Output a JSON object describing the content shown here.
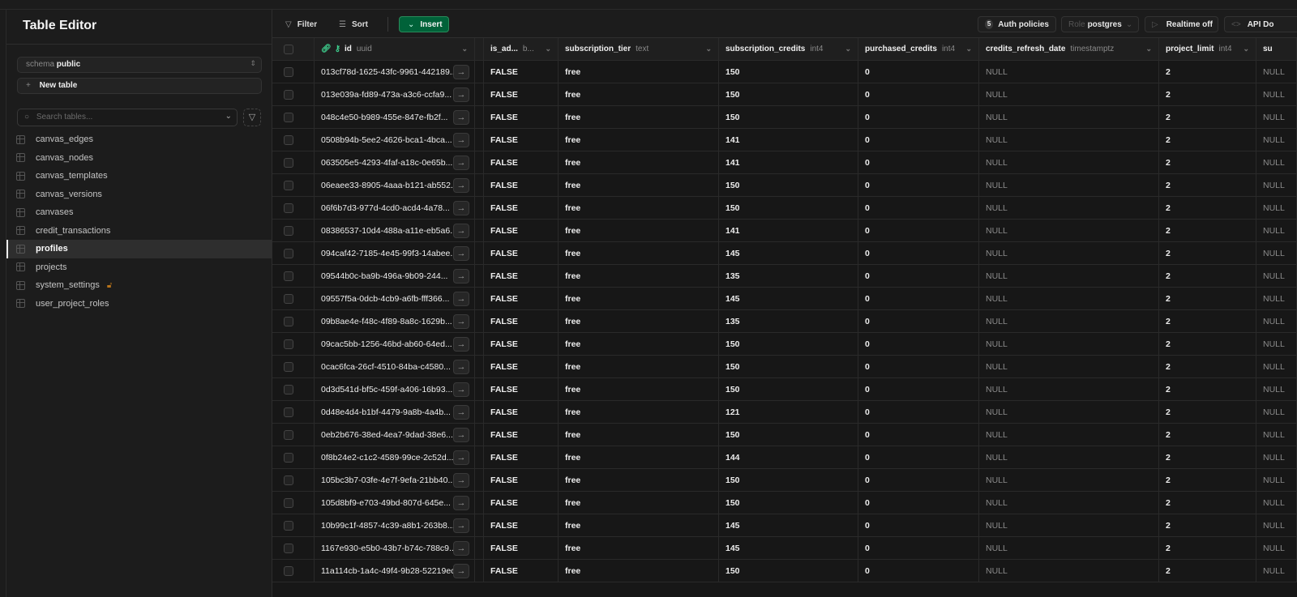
{
  "sidebar": {
    "title": "Table Editor",
    "schema_label": "schema",
    "schema_value": "public",
    "new_table": "New table",
    "search_placeholder": "Search tables...",
    "tables": [
      {
        "name": "canvas_edges"
      },
      {
        "name": "canvas_nodes"
      },
      {
        "name": "canvas_templates"
      },
      {
        "name": "canvas_versions"
      },
      {
        "name": "canvases"
      },
      {
        "name": "credit_transactions"
      },
      {
        "name": "profiles",
        "active": true
      },
      {
        "name": "projects"
      },
      {
        "name": "system_settings",
        "locked": true
      },
      {
        "name": "user_project_roles"
      }
    ]
  },
  "toolbar": {
    "filter": "Filter",
    "sort": "Sort",
    "insert": "Insert",
    "auth_count": "5",
    "auth_policies": "Auth policies",
    "role_label": "Role",
    "role_value": "postgres",
    "realtime": "Realtime off",
    "api_docs": "API Do"
  },
  "colors": {
    "accent": "#006239",
    "lock": "#b8741a",
    "background": "#171717"
  },
  "table": {
    "columns": [
      {
        "name": "id",
        "type": "uuid"
      },
      {
        "name": "",
        "type": ""
      },
      {
        "name": "is_ad...",
        "type": "b..."
      },
      {
        "name": "subscription_tier",
        "type": "text"
      },
      {
        "name": "subscription_credits",
        "type": "int4"
      },
      {
        "name": "purchased_credits",
        "type": "int4"
      },
      {
        "name": "credits_refresh_date",
        "type": "timestamptz"
      },
      {
        "name": "project_limit",
        "type": "int4"
      },
      {
        "name": "su",
        "type": ""
      }
    ],
    "rows": [
      [
        "013cf78d-1625-43fc-9961-442189...",
        "FALSE",
        "free",
        "150",
        "0",
        "NULL",
        "2",
        "NULL"
      ],
      [
        "013e039a-fd89-473a-a3c6-ccfa9...",
        "FALSE",
        "free",
        "150",
        "0",
        "NULL",
        "2",
        "NULL"
      ],
      [
        "048c4e50-b989-455e-847e-fb2f...",
        "FALSE",
        "free",
        "150",
        "0",
        "NULL",
        "2",
        "NULL"
      ],
      [
        "0508b94b-5ee2-4626-bca1-4bca...",
        "FALSE",
        "free",
        "141",
        "0",
        "NULL",
        "2",
        "NULL"
      ],
      [
        "063505e5-4293-4faf-a18c-0e65b...",
        "FALSE",
        "free",
        "141",
        "0",
        "NULL",
        "2",
        "NULL"
      ],
      [
        "06eaee33-8905-4aaa-b121-ab552...",
        "FALSE",
        "free",
        "150",
        "0",
        "NULL",
        "2",
        "NULL"
      ],
      [
        "06f6b7d3-977d-4cd0-acd4-4a78...",
        "FALSE",
        "free",
        "150",
        "0",
        "NULL",
        "2",
        "NULL"
      ],
      [
        "08386537-10d4-488a-a11e-eb5a6...",
        "FALSE",
        "free",
        "141",
        "0",
        "NULL",
        "2",
        "NULL"
      ],
      [
        "094caf42-7185-4e45-99f3-14abee...",
        "FALSE",
        "free",
        "145",
        "0",
        "NULL",
        "2",
        "NULL"
      ],
      [
        "09544b0c-ba9b-496a-9b09-244...",
        "FALSE",
        "free",
        "135",
        "0",
        "NULL",
        "2",
        "NULL"
      ],
      [
        "09557f5a-0dcb-4cb9-a6fb-fff366...",
        "FALSE",
        "free",
        "145",
        "0",
        "NULL",
        "2",
        "NULL"
      ],
      [
        "09b8ae4e-f48c-4f89-8a8c-1629b...",
        "FALSE",
        "free",
        "135",
        "0",
        "NULL",
        "2",
        "NULL"
      ],
      [
        "09cac5bb-1256-46bd-ab60-64ed...",
        "FALSE",
        "free",
        "150",
        "0",
        "NULL",
        "2",
        "NULL"
      ],
      [
        "0cac6fca-26cf-4510-84ba-c4580...",
        "FALSE",
        "free",
        "150",
        "0",
        "NULL",
        "2",
        "NULL"
      ],
      [
        "0d3d541d-bf5c-459f-a406-16b93...",
        "FALSE",
        "free",
        "150",
        "0",
        "NULL",
        "2",
        "NULL"
      ],
      [
        "0d48e4d4-b1bf-4479-9a8b-4a4b...",
        "FALSE",
        "free",
        "121",
        "0",
        "NULL",
        "2",
        "NULL"
      ],
      [
        "0eb2b676-38ed-4ea7-9dad-38e6...",
        "FALSE",
        "free",
        "150",
        "0",
        "NULL",
        "2",
        "NULL"
      ],
      [
        "0f8b24e2-c1c2-4589-99ce-2c52d...",
        "FALSE",
        "free",
        "144",
        "0",
        "NULL",
        "2",
        "NULL"
      ],
      [
        "105bc3b7-03fe-4e7f-9efa-21bb40...",
        "FALSE",
        "free",
        "150",
        "0",
        "NULL",
        "2",
        "NULL"
      ],
      [
        "105d8bf9-e703-49bd-807d-645e...",
        "FALSE",
        "free",
        "150",
        "0",
        "NULL",
        "2",
        "NULL"
      ],
      [
        "10b99c1f-4857-4c39-a8b1-263b8...",
        "FALSE",
        "free",
        "145",
        "0",
        "NULL",
        "2",
        "NULL"
      ],
      [
        "1167e930-e5b0-43b7-b74c-788c9...",
        "FALSE",
        "free",
        "145",
        "0",
        "NULL",
        "2",
        "NULL"
      ],
      [
        "11a114cb-1a4c-49f4-9b28-52219ec...",
        "FALSE",
        "free",
        "150",
        "0",
        "NULL",
        "2",
        "NULL"
      ]
    ]
  }
}
